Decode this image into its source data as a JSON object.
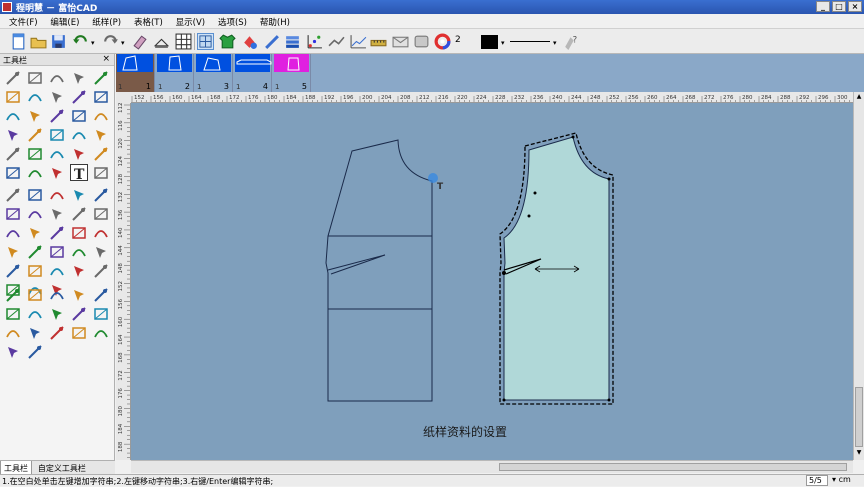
{
  "window": {
    "title": "程明慧 － 富怡CAD"
  },
  "menu": [
    {
      "label": "文件(F)"
    },
    {
      "label": "编辑(E)"
    },
    {
      "label": "纸样(P)"
    },
    {
      "label": "表格(T)"
    },
    {
      "label": "显示(V)"
    },
    {
      "label": "选项(S)"
    },
    {
      "label": "帮助(H)"
    }
  ],
  "toolbar": {
    "pen_number": "2",
    "pen_color": "#000000",
    "icons": [
      "new-icon",
      "open-icon",
      "save-icon",
      "undo-icon",
      "redo-icon",
      "eraser-icon",
      "hanger-icon",
      "grid-table-icon",
      "piece-list-icon",
      "shirt-icon",
      "color-fill-icon",
      "ruler-icon",
      "stack-icon",
      "dot-grid-icon",
      "measure-icon",
      "chart-icon",
      "tape-icon",
      "envelope-icon",
      "layers-icon",
      "color-wheel-icon",
      "help-icon"
    ]
  },
  "left_panel": {
    "title": "工具栏",
    "close": "×",
    "tabs": [
      "工具栏",
      "自定义工具栏"
    ],
    "selected_tool": "text-tool-icon",
    "tools_group1": [
      "select-arrow-icon",
      "smart-pen-icon",
      "adjust-icon",
      "cut-icon",
      "pencil-icon",
      "curve-icon",
      "dart-icon",
      "pleat-icon",
      "join-icon",
      "arc-icon",
      "rotate-icon",
      "scissors-icon",
      "button-icon",
      "measure-line-icon",
      "mirror-icon",
      "star-icon",
      "compass-icon",
      "eyelet-icon",
      "protractor-icon",
      "align-icon",
      "triangle-icon",
      "fold-icon",
      "shirt-sleeve-icon",
      "flip-icon",
      "stack-piece-icon",
      "flag-icon",
      "ruler-tool-icon",
      "spiral-icon",
      "text-tool-icon",
      "grid-tool-icon"
    ],
    "tools_group2": [
      "cloud-icon",
      "pocket-icon",
      "boot-icon",
      "thread-icon",
      "wave-icon",
      "stitch-icon",
      "cup-icon",
      "radar-icon",
      "crosshair-icon",
      "layout-icon",
      "notch-icon",
      "cut-line-icon",
      "fabric-icon",
      "ribbon-icon",
      "tag-icon",
      "piece-tool-icon",
      "grade-icon",
      "paint-icon",
      "sleeve-icon",
      "drop-icon",
      "shape-icon",
      "stripe-icon",
      "measure-tool-icon",
      "rotate-tool-icon",
      "pleat-tool-icon",
      "square-icon",
      "pattern-icon",
      "column-icon"
    ],
    "tools_group3": [
      "grade-point-icon",
      "grade-copy-icon",
      "grade-size-icon",
      "grade-scale-icon",
      "grade-shirt-icon",
      "grade-rect-icon",
      "grade-curve-icon",
      "grade-sweep-icon",
      "grade-swing-icon",
      "grade-arc-icon",
      "grade-frame-icon",
      "grade-angle-icon",
      "grade-fan-icon",
      "grade-leg-icon",
      "grade-blank-icon",
      "grade-chart-icon",
      "grade-grow-icon"
    ]
  },
  "pieces": [
    {
      "number": "1",
      "count": "1",
      "color": "#0050e0",
      "fill": "#7a5a48"
    },
    {
      "number": "2",
      "count": "1",
      "color": "#0050e0",
      "fill": "#8aa8c8"
    },
    {
      "number": "3",
      "count": "1",
      "color": "#0050e0",
      "fill": "#8aa8c8"
    },
    {
      "number": "4",
      "count": "1",
      "color": "#0050e0",
      "fill": "#8aa8c8"
    },
    {
      "number": "5",
      "count": "1",
      "color": "#e020e0",
      "fill": "#8aa8c8"
    }
  ],
  "ruler": {
    "h_ticks": [
      "152",
      "156",
      "160",
      "164",
      "168",
      "172",
      "176",
      "180",
      "184",
      "188",
      "192",
      "196",
      "200",
      "204",
      "208",
      "212",
      "216",
      "220",
      "224",
      "228",
      "232",
      "236",
      "240",
      "244",
      "248",
      "252",
      "256",
      "260",
      "264",
      "268",
      "272",
      "276",
      "280",
      "284",
      "288",
      "292",
      "296",
      "300"
    ],
    "v_ticks": [
      "112",
      "116",
      "120",
      "124",
      "128",
      "132",
      "136",
      "140",
      "144",
      "148",
      "152",
      "156",
      "160",
      "164",
      "168",
      "172",
      "176",
      "180",
      "184",
      "188"
    ]
  },
  "canvas": {
    "caption": "纸样资料的设置",
    "background": "#7f9fbc",
    "piece_fill": "#b0d8d8",
    "cursor_label": "T"
  },
  "statusbar": {
    "message": "1.在空白处单击左键增加字符串;2.左键移动字符串;3.右键/Enter编辑字符串;",
    "page": "5/5",
    "unit": "cm"
  }
}
